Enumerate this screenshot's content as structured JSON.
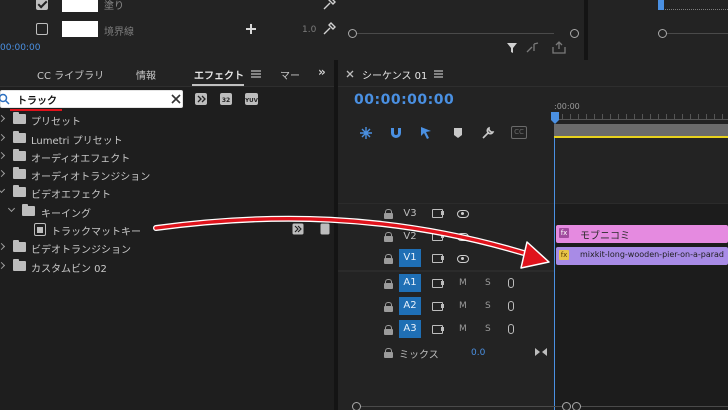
{
  "top": {
    "fill_label": "塗り",
    "stroke_label": "境界線",
    "stroke_value": "1.0",
    "left_timecode": "00:00:00"
  },
  "effects_panel": {
    "tabs": [
      {
        "label": "CC ライブラリ"
      },
      {
        "label": "情報"
      },
      {
        "label": "エフェクト"
      },
      {
        "label": "マー"
      }
    ],
    "search": {
      "value": "トラック",
      "placeholder": ""
    },
    "tree": [
      {
        "label": "プリセット"
      },
      {
        "label": "Lumetri プリセット"
      },
      {
        "label": "オーディオエフェクト"
      },
      {
        "label": "オーディオトランジション"
      },
      {
        "label": "ビデオエフェクト"
      },
      {
        "label": "キーイング"
      },
      {
        "label": "トラックマットキー"
      },
      {
        "label": "ビデオトランジション"
      },
      {
        "label": "カスタムビン 02"
      }
    ]
  },
  "timeline": {
    "sequence_title": "シーケンス 01",
    "timecode": "00:00:00:00",
    "ruler_label": ":00:00",
    "video_tracks": [
      {
        "label": "V3",
        "targeted": false
      },
      {
        "label": "V2",
        "targeted": false
      },
      {
        "label": "V1",
        "targeted": true
      }
    ],
    "audio_tracks": [
      {
        "label": "A1",
        "m": "M",
        "s": "S"
      },
      {
        "label": "A2",
        "m": "M",
        "s": "S"
      },
      {
        "label": "A3",
        "m": "M",
        "s": "S"
      }
    ],
    "mix_label": "ミックス",
    "mix_value": "0.0",
    "cc_label": "CC",
    "clips": [
      {
        "track": "V2",
        "label": "モブニコミ",
        "fx": "fx"
      },
      {
        "track": "V1",
        "label": "mixkit-long-wooden-pier-on-a-parad",
        "fx": "fx"
      }
    ]
  },
  "colors": {
    "accent_blue": "#4a90e2",
    "track_target": "#1f6fb5",
    "clip_pink": "#e58ae0",
    "clip_purple": "#a88be6",
    "arrow_red": "#e0131c"
  }
}
